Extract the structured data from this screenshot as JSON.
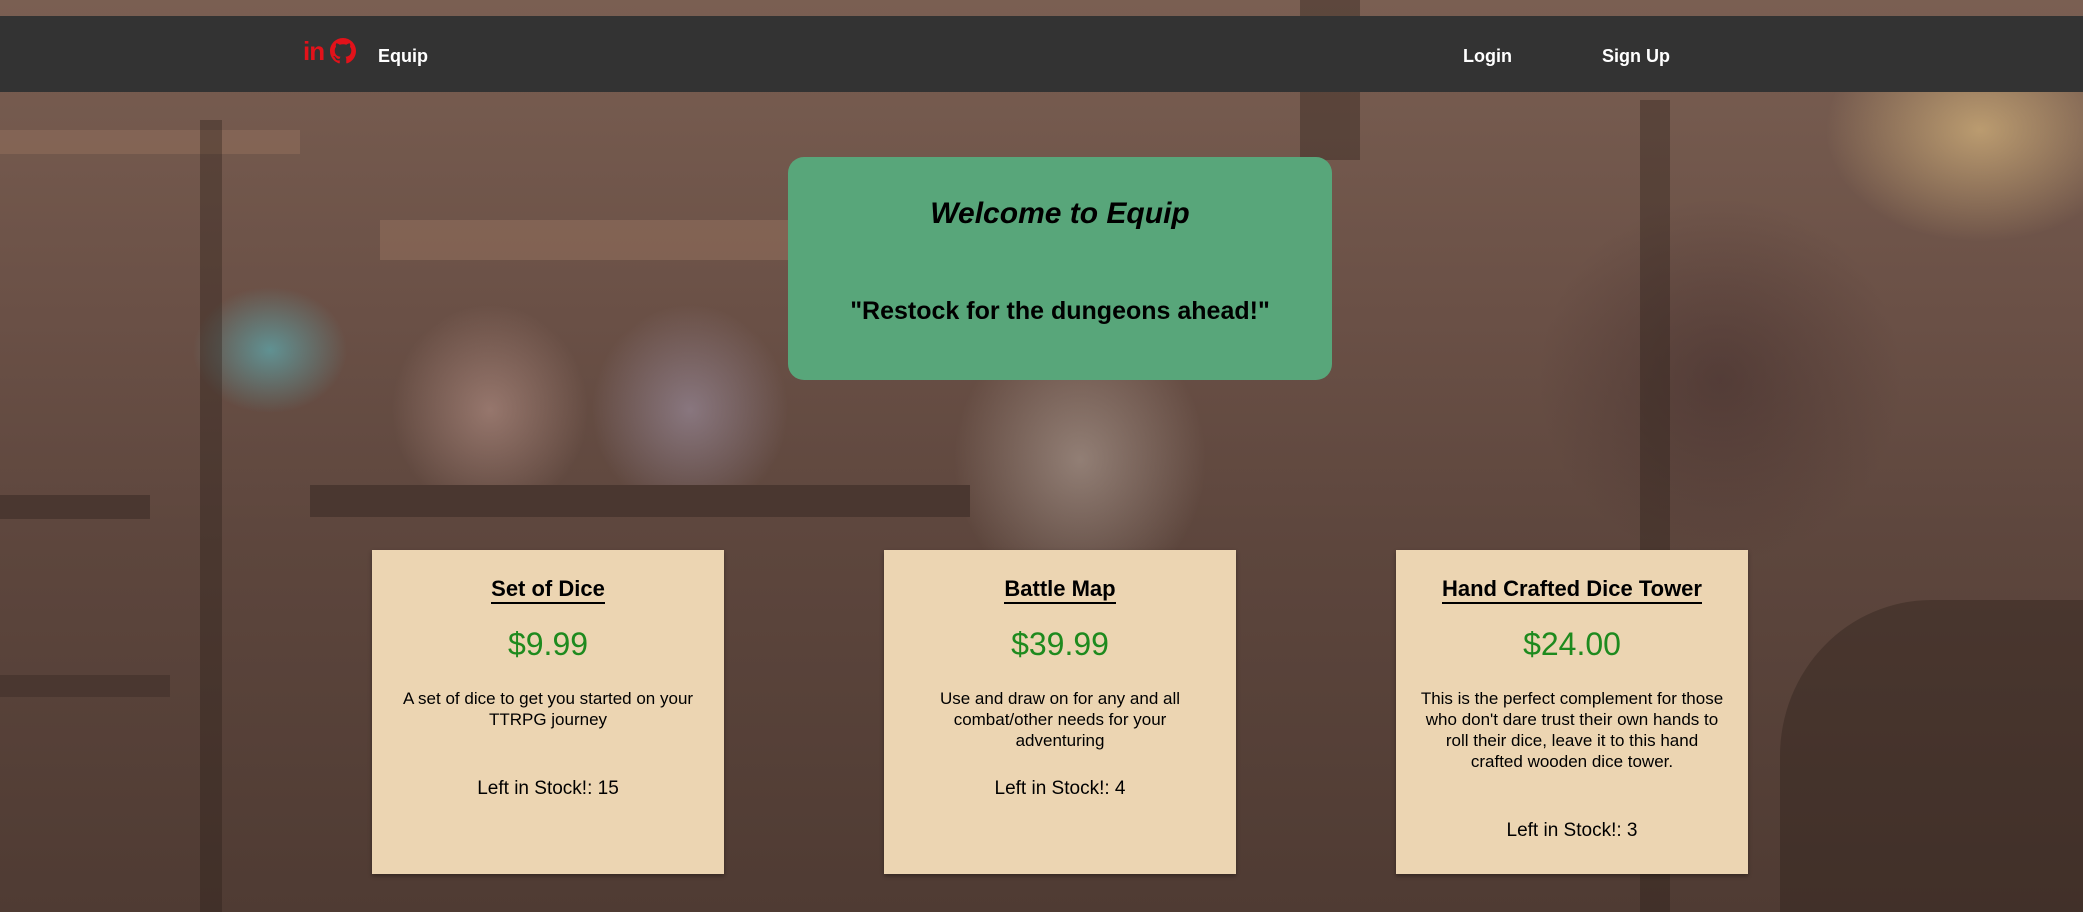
{
  "nav": {
    "brand": "Equip",
    "icons": [
      "linkedin-icon",
      "github-icon"
    ],
    "linkedin_glyph": "in",
    "login_label": "Login",
    "signup_label": "Sign Up"
  },
  "hero": {
    "title": "Welcome to Equip",
    "tagline": "\"Restock for the dungeons ahead!\""
  },
  "products": [
    {
      "name": "Set of Dice",
      "price": "$9.99",
      "description": "A set of dice to get you started on your TTRPG journey",
      "stock": "Left in Stock!: 15"
    },
    {
      "name": "Battle Map",
      "price": "$39.99",
      "description": "Use and draw on for any and all combat/other needs for your adventuring",
      "stock": "Left in Stock!: 4"
    },
    {
      "name": "Hand Crafted Dice Tower",
      "price": "$24.00",
      "description": "This is the perfect complement for those who don't dare trust their own hands to roll their dice, leave it to this hand crafted wooden dice tower.",
      "stock": "Left in Stock!: 3"
    }
  ],
  "colors": {
    "navbar": "#333333",
    "hero": "#58a67a",
    "card": "#ecd5b2",
    "price": "#1e8a1e",
    "icon_accent": "#e2121a"
  }
}
